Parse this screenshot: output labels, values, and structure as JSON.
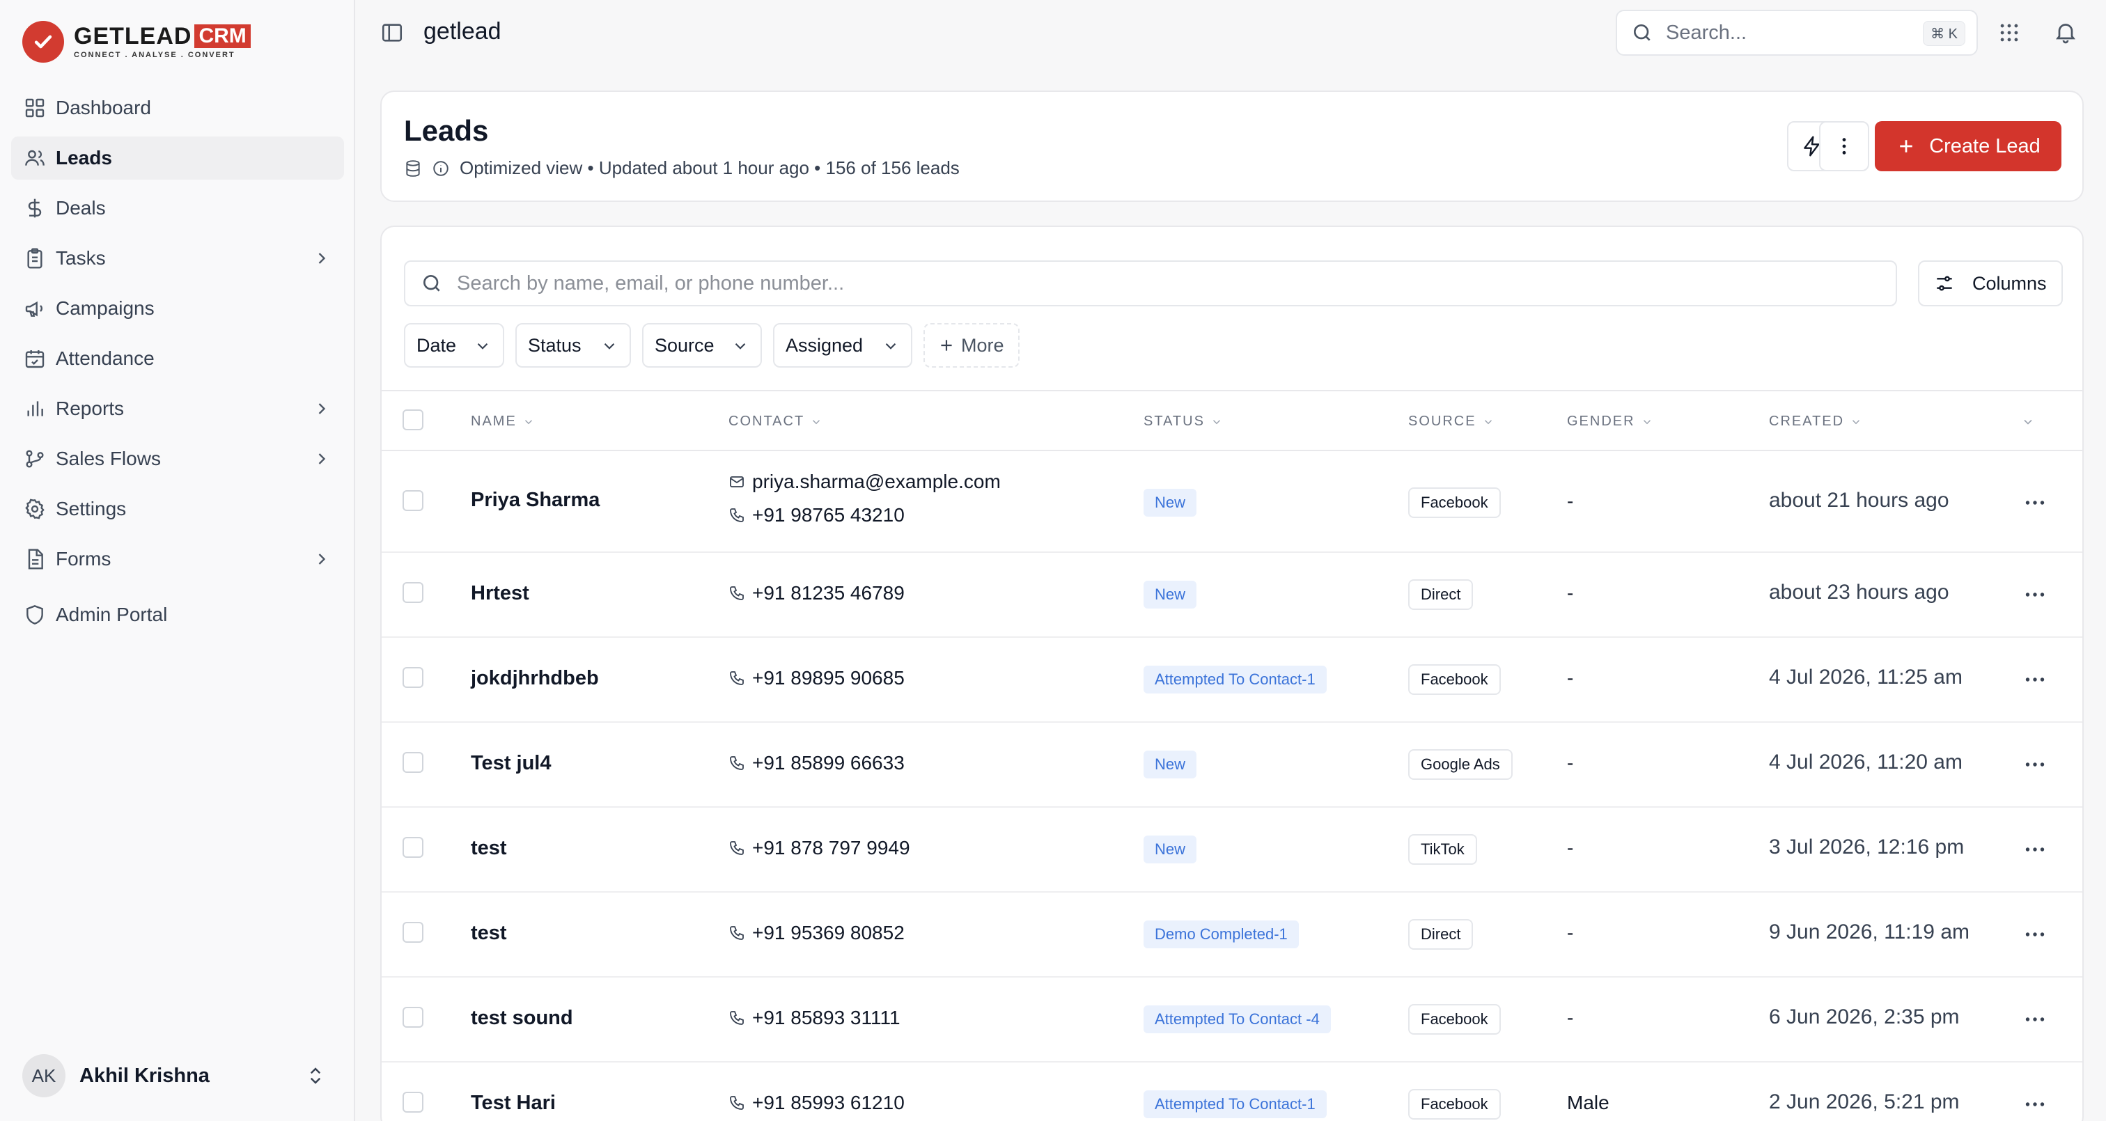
{
  "brand": {
    "name": "GETLEAD",
    "badge": "CRM",
    "tagline": "CONNECT . ANALYSE . CONVERT"
  },
  "sidebar": {
    "items": [
      {
        "label": "Dashboard",
        "icon": "dashboard-icon",
        "active": false,
        "has_chevron": false
      },
      {
        "label": "Leads",
        "icon": "users-icon",
        "active": true,
        "has_chevron": false
      },
      {
        "label": "Deals",
        "icon": "dollar-icon",
        "active": false,
        "has_chevron": false
      },
      {
        "label": "Tasks",
        "icon": "clipboard-icon",
        "active": false,
        "has_chevron": true
      },
      {
        "label": "Campaigns",
        "icon": "megaphone-icon",
        "active": false,
        "has_chevron": false
      },
      {
        "label": "Attendance",
        "icon": "calendar-check-icon",
        "active": false,
        "has_chevron": false
      },
      {
        "label": "Reports",
        "icon": "bar-chart-icon",
        "active": false,
        "has_chevron": true
      },
      {
        "label": "Sales Flows",
        "icon": "git-branch-icon",
        "active": false,
        "has_chevron": true
      },
      {
        "label": "Settings",
        "icon": "gear-icon",
        "active": false,
        "has_chevron": false
      },
      {
        "label": "Forms",
        "icon": "form-icon",
        "active": false,
        "has_chevron": true
      },
      {
        "label": "Admin Portal",
        "icon": "shield-icon",
        "active": false,
        "has_chevron": false
      }
    ],
    "user": {
      "initials": "AK",
      "name": "Akhil Krishna"
    }
  },
  "topbar": {
    "breadcrumb": "getlead",
    "search_placeholder": "Search...",
    "search_shortcut": "⌘ K"
  },
  "header": {
    "title": "Leads",
    "meta": "Optimized view • Updated about 1 hour ago • 156 of 156 leads",
    "create_label": "Create Lead"
  },
  "table": {
    "search_placeholder": "Search by name, email, or phone number...",
    "columns_label": "Columns",
    "filters": [
      "Date",
      "Status",
      "Source",
      "Assigned"
    ],
    "more_label": "More",
    "headers": [
      "NAME",
      "CONTACT",
      "STATUS",
      "SOURCE",
      "GENDER",
      "CREATED"
    ],
    "rows": [
      {
        "name": "Priya Sharma",
        "email": "priya.sharma@example.com",
        "phone": "+91 98765 43210",
        "status": "New",
        "source": "Facebook",
        "gender": "-",
        "created": "about 21 hours ago"
      },
      {
        "name": "Hrtest",
        "email": "",
        "phone": "+91 81235 46789",
        "status": "New",
        "source": "Direct",
        "gender": "-",
        "created": "about 23 hours ago"
      },
      {
        "name": "jokdjhrhdbeb",
        "email": "",
        "phone": "+91 89895 90685",
        "status": "Attempted To Contact-1",
        "source": "Facebook",
        "gender": "-",
        "created": "4 Jul 2026, 11:25 am"
      },
      {
        "name": "Test jul4",
        "email": "",
        "phone": "+91 85899 66633",
        "status": "New",
        "source": "Google Ads",
        "gender": "-",
        "created": "4 Jul 2026, 11:20 am"
      },
      {
        "name": "test",
        "email": "",
        "phone": "+91 878 797 9949",
        "status": "New",
        "source": "TikTok",
        "gender": "-",
        "created": "3 Jul 2026, 12:16 pm"
      },
      {
        "name": "test",
        "email": "",
        "phone": "+91 95369 80852",
        "status": "Demo Completed-1",
        "source": "Direct",
        "gender": "-",
        "created": "9 Jun 2026, 11:19 am"
      },
      {
        "name": "test sound",
        "email": "",
        "phone": "+91 85893 31111",
        "status": "Attempted To Contact -4",
        "source": "Facebook",
        "gender": "-",
        "created": "6 Jun 2026, 2:35 pm"
      },
      {
        "name": "Test Hari",
        "email": "",
        "phone": "+91 85993 61210",
        "status": "Attempted To Contact-1",
        "source": "Facebook",
        "gender": "Male",
        "created": "2 Jun 2026, 5:21 pm"
      }
    ]
  },
  "colors": {
    "accent": "#d3352c",
    "status_bg": "#eaf1fd",
    "status_text": "#3b73d9"
  }
}
